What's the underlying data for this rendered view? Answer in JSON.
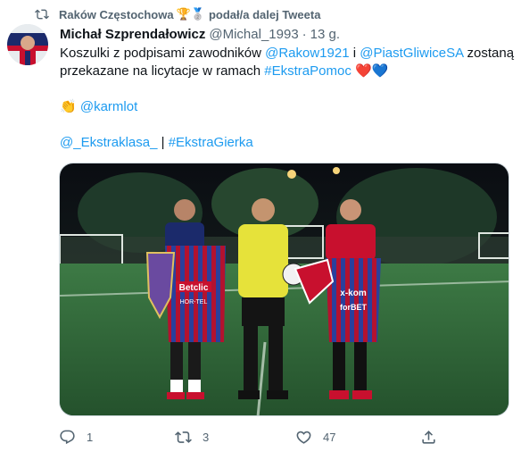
{
  "retweet": {
    "user": "Raków Częstochowa",
    "badges": "🏆🥈",
    "suffix": "podał/a dalej Tweeta"
  },
  "tweet": {
    "author_name": "Michał Szprendałowicz",
    "author_handle": "@Michal_1993",
    "separator": "·",
    "time": "13 g.",
    "line1_pre": "Koszulki z podpisami zawodników ",
    "mention_rakow": "@Rakow1921",
    "line1_mid": " i ",
    "mention_piast": "@PiastGliwiceSA",
    "line1_post": " zostaną",
    "line2_pre": "przekazane na licytacje w ramach ",
    "hashtag_pomoc": "#EkstraPomoc",
    "hearts_red": "❤️",
    "hearts_blue": "💙",
    "line3_emoji": "👏",
    "mention_karmlot": "@karmlot",
    "mention_ekstraklasa": "@_Ekstraklasa_",
    "line4_sep": " | ",
    "hashtag_gierka": "#EkstraGierka"
  },
  "actions": {
    "reply_count": "1",
    "retweet_count": "3",
    "like_count": "47"
  },
  "media": {
    "jersey_left_text": "Betclic",
    "jersey_left_sub": "HOR-TEL",
    "jersey_right_text": "x-kom",
    "jersey_right_sub": "forBET"
  },
  "colors": {
    "link": "#1d9bf0",
    "muted": "#536471",
    "text": "#0f1419",
    "jersey_blue": "#2a3f9c",
    "jersey_red": "#c8102e",
    "referee_yellow": "#e6e23a",
    "pitch": "#2f6b3a"
  },
  "icons": {
    "retweet": "retweet-icon",
    "reply": "reply-icon",
    "like": "heart-icon",
    "share": "share-icon"
  }
}
